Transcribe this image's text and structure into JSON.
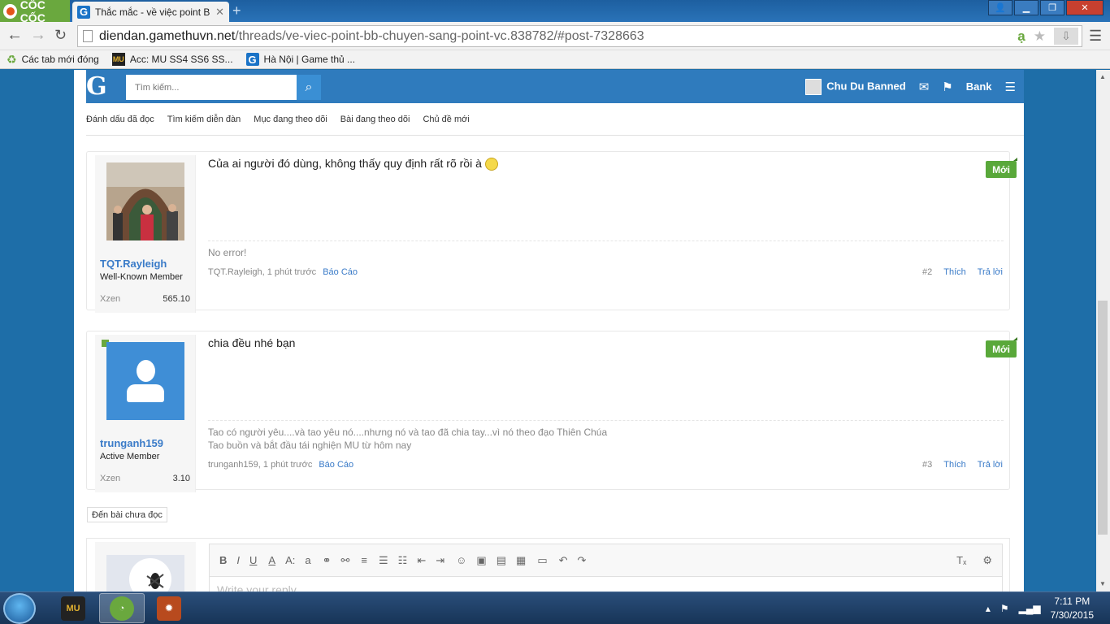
{
  "browser": {
    "brand": "CỐC CỐC",
    "tab_title": "Thắc mắc - về việc point BB",
    "url_domain": "diendan.gamethuvn.net",
    "url_path": "/threads/ve-viec-point-bb-chuyen-sang-point-vc.838782/#post-7328663",
    "bookmarks": [
      {
        "label": "Các tab mới đóng",
        "icon": "recycle-icon"
      },
      {
        "label": "Acc: MU SS4 SS6 SS...",
        "icon": "mu-icon"
      },
      {
        "label": "Hà Nội | Game thủ ...",
        "icon": "gamethu-icon"
      }
    ]
  },
  "site": {
    "logo": "G",
    "search_placeholder": "Tìm kiếm...",
    "user_name": "Chu Du Banned",
    "bank_label": "Bank",
    "subnav": [
      "Đánh dấu đã đọc",
      "Tìm kiếm diễn đàn",
      "Mục đang theo dõi",
      "Bài đang theo dõi",
      "Chủ đề mới"
    ]
  },
  "posts": [
    {
      "username": "TQT.Rayleigh",
      "user_title": "Well-Known Member",
      "stat_label": "Xzen",
      "stat_value": "565.10",
      "message": "Của ai người đó dùng, không thấy quy định rất rõ rồi à",
      "badge": "Mới",
      "signature": [
        "No error!"
      ],
      "meta_author": "TQT.Rayleigh, 1 phút trước",
      "report": "Báo Cáo",
      "post_no": "#2",
      "like": "Thích",
      "reply": "Trả lời"
    },
    {
      "username": "trunganh159",
      "user_title": "Active Member",
      "stat_label": "Xzen",
      "stat_value": "3.10",
      "message": "chia đều nhé bạn",
      "badge": "Mới",
      "signature": [
        "Tao có người yêu....và tao yêu nó....nhưng nó và tao đã chia tay...vì nó theo đạo Thiên Chúa",
        "Tao buồn và bắt đầu tái nghiện MU từ hôm nay"
      ],
      "meta_author": "trunganh159, 1 phút trước",
      "report": "Báo Cáo",
      "post_no": "#3",
      "like": "Thích",
      "reply": "Trả lời"
    }
  ],
  "unread_button": "Đến bài chưa đọc",
  "editor": {
    "placeholder": "Write your reply...",
    "tools": [
      "B",
      "I",
      "U",
      "A",
      "A:",
      "a",
      "link",
      "unlink",
      "align",
      "list",
      "numlist",
      "outdent",
      "indent",
      "smilie",
      "image",
      "media",
      "code",
      "save",
      "undo",
      "redo"
    ]
  },
  "taskbar": {
    "time": "7:11 PM",
    "date": "7/30/2015"
  },
  "colors": {
    "header_blue": "#2f7bbd",
    "badge_green": "#59a83a",
    "link_blue": "#3a7bc8"
  }
}
